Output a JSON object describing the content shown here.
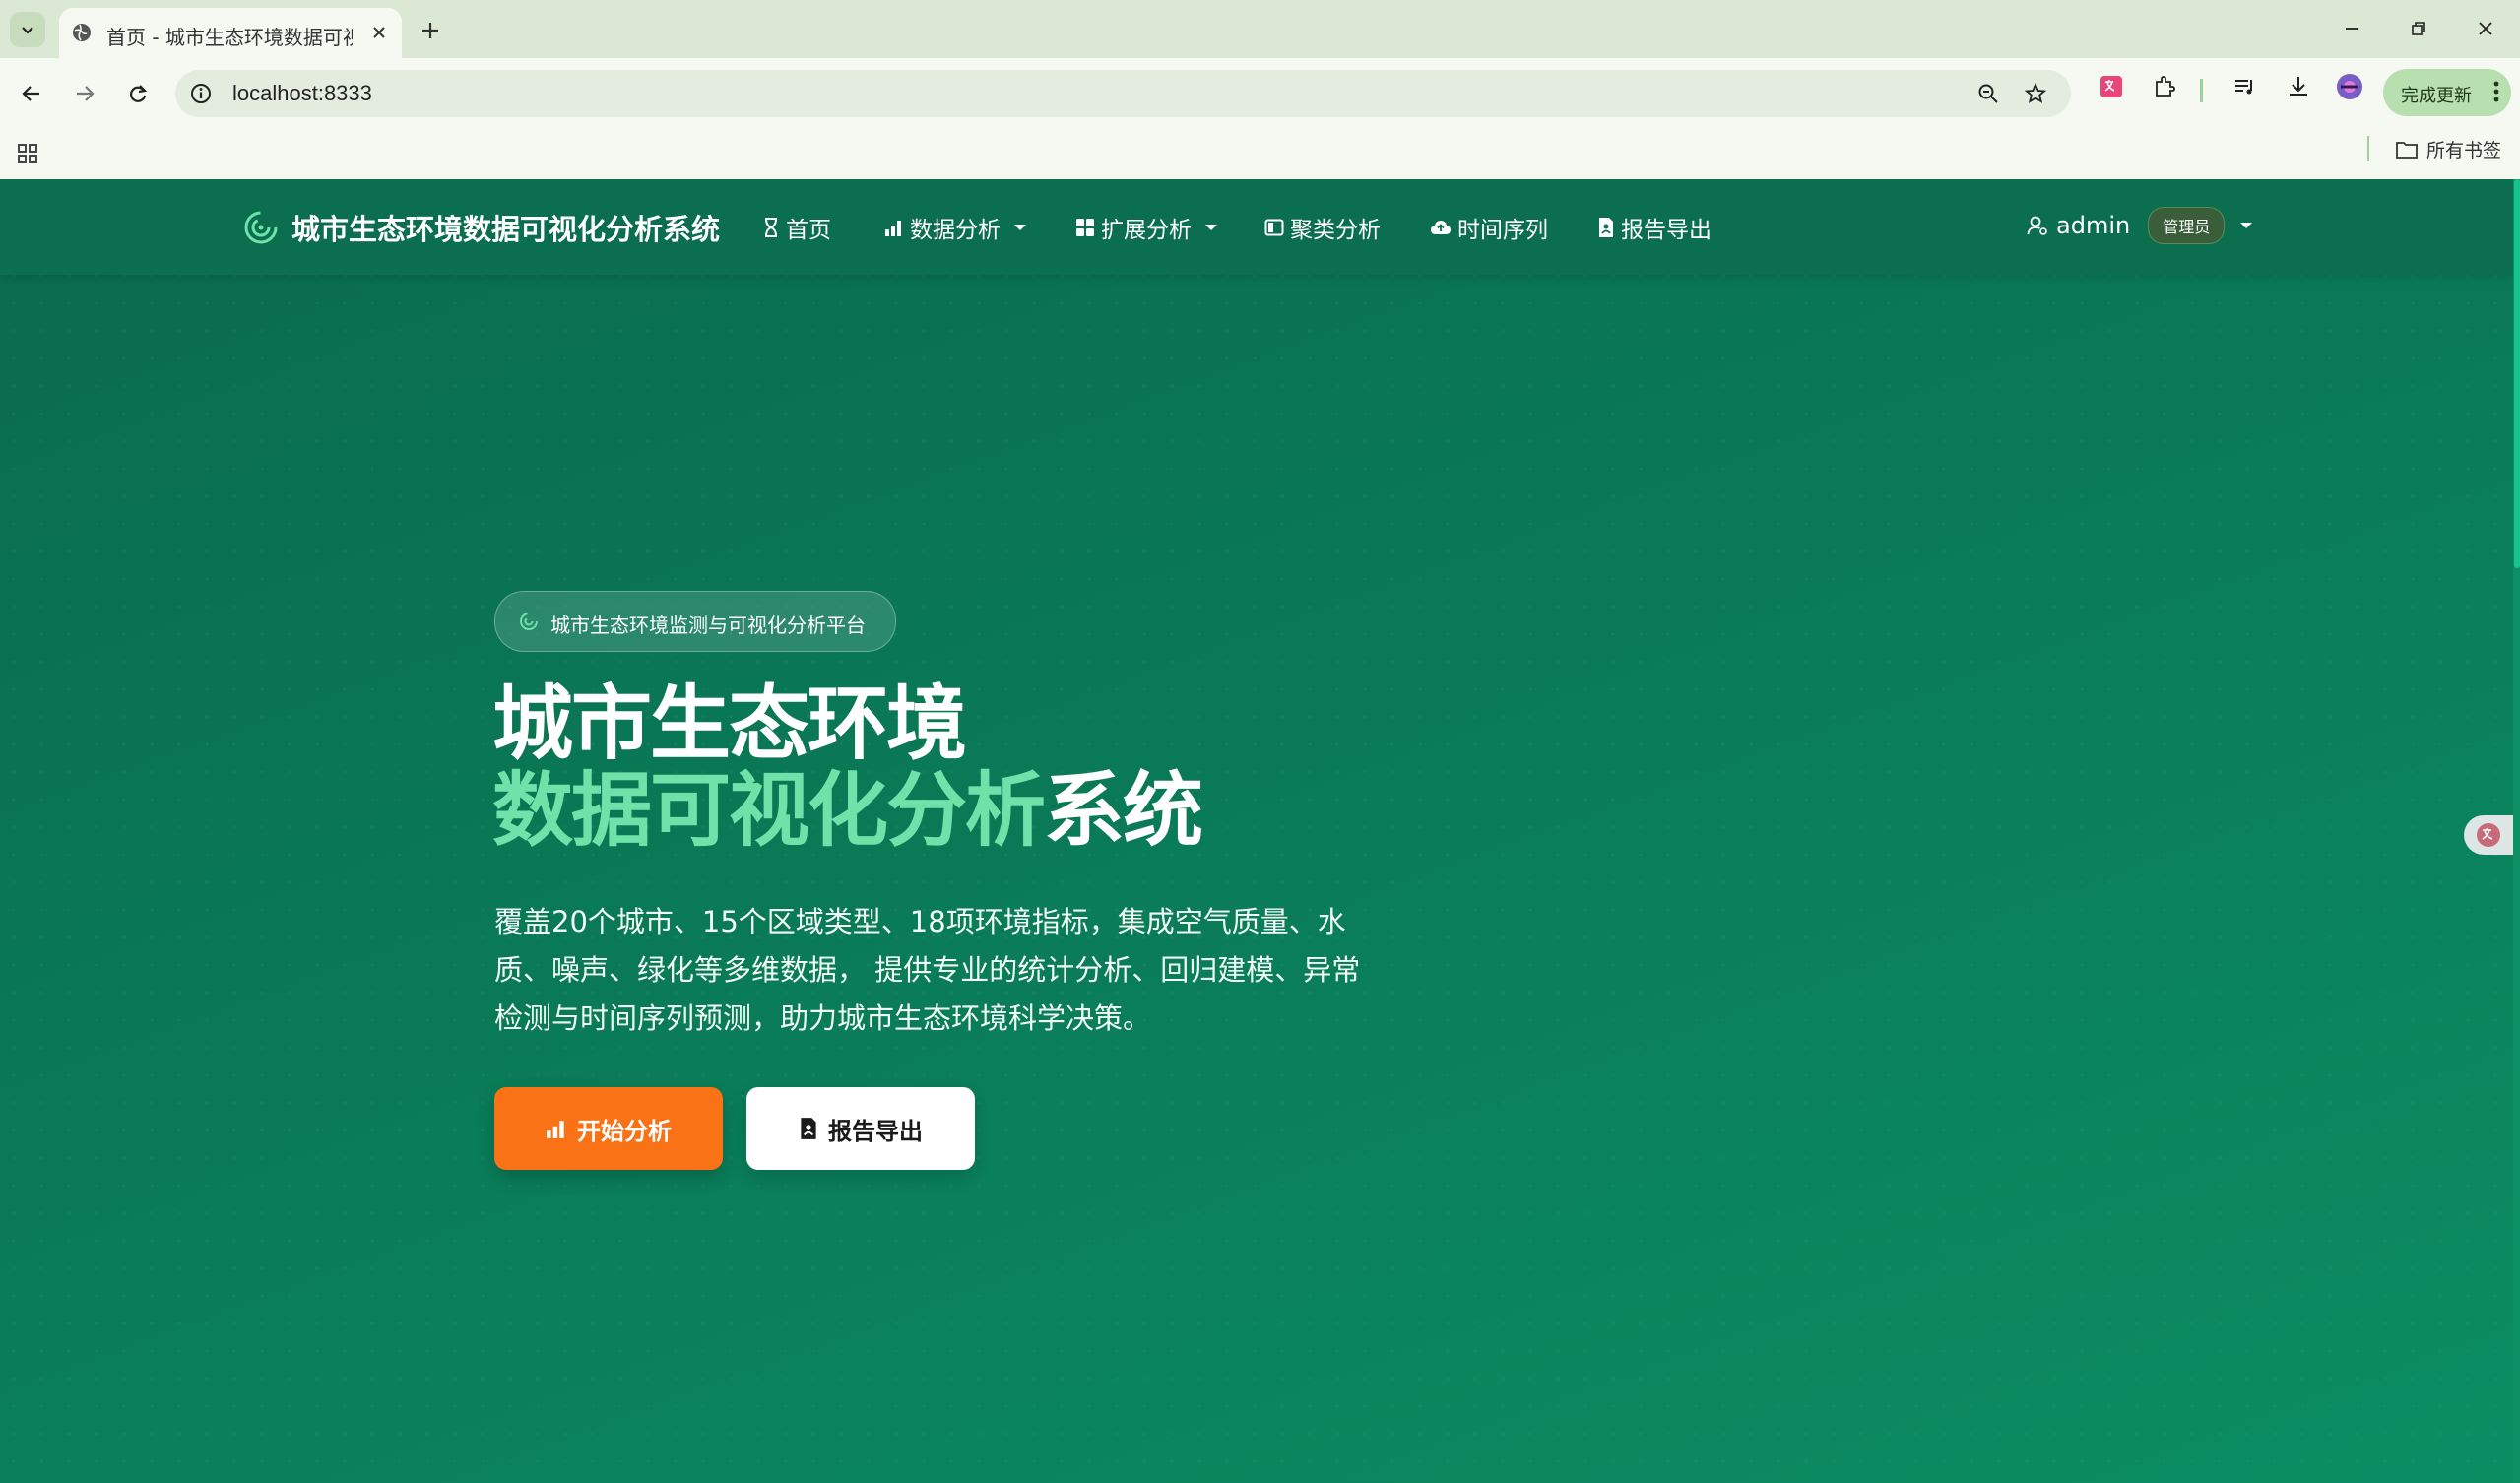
{
  "browser": {
    "tab_title": "首页 - 城市生态环境数据可视化",
    "url": "localhost:8333",
    "update_button": "完成更新",
    "bookmarks_all": "所有书签"
  },
  "nav": {
    "brand": "城市生态环境数据可视化分析系统",
    "items": [
      {
        "label": "首页",
        "icon": "hourglass-icon"
      },
      {
        "label": "数据分析",
        "icon": "bar-chart-icon",
        "dropdown": true
      },
      {
        "label": "扩展分析",
        "icon": "grid-icon",
        "dropdown": true
      },
      {
        "label": "聚类分析",
        "icon": "layout-icon"
      },
      {
        "label": "时间序列",
        "icon": "cloud-icon"
      },
      {
        "label": "报告导出",
        "icon": "file-icon"
      }
    ],
    "user": "admin",
    "role": "管理员"
  },
  "hero": {
    "pill": "城市生态环境监测与可视化分析平台",
    "title_line1": "城市生态环境",
    "title_line2_highlight": "数据可视化分析",
    "title_line2_rest": "系统",
    "description": "覆盖20个城市、15个区域类型、18项环境指标，集成空气质量、水质、噪声、绿化等多维数据， 提供专业的统计分析、回归建模、异常检测与时间序列预测，助力城市生态环境科学决策。",
    "btn_primary": "开始分析",
    "btn_secondary": "报告导出"
  },
  "colors": {
    "navbar": "#0b6e4e",
    "highlight": "#6ee2a8",
    "primary_button": "#f97316"
  }
}
